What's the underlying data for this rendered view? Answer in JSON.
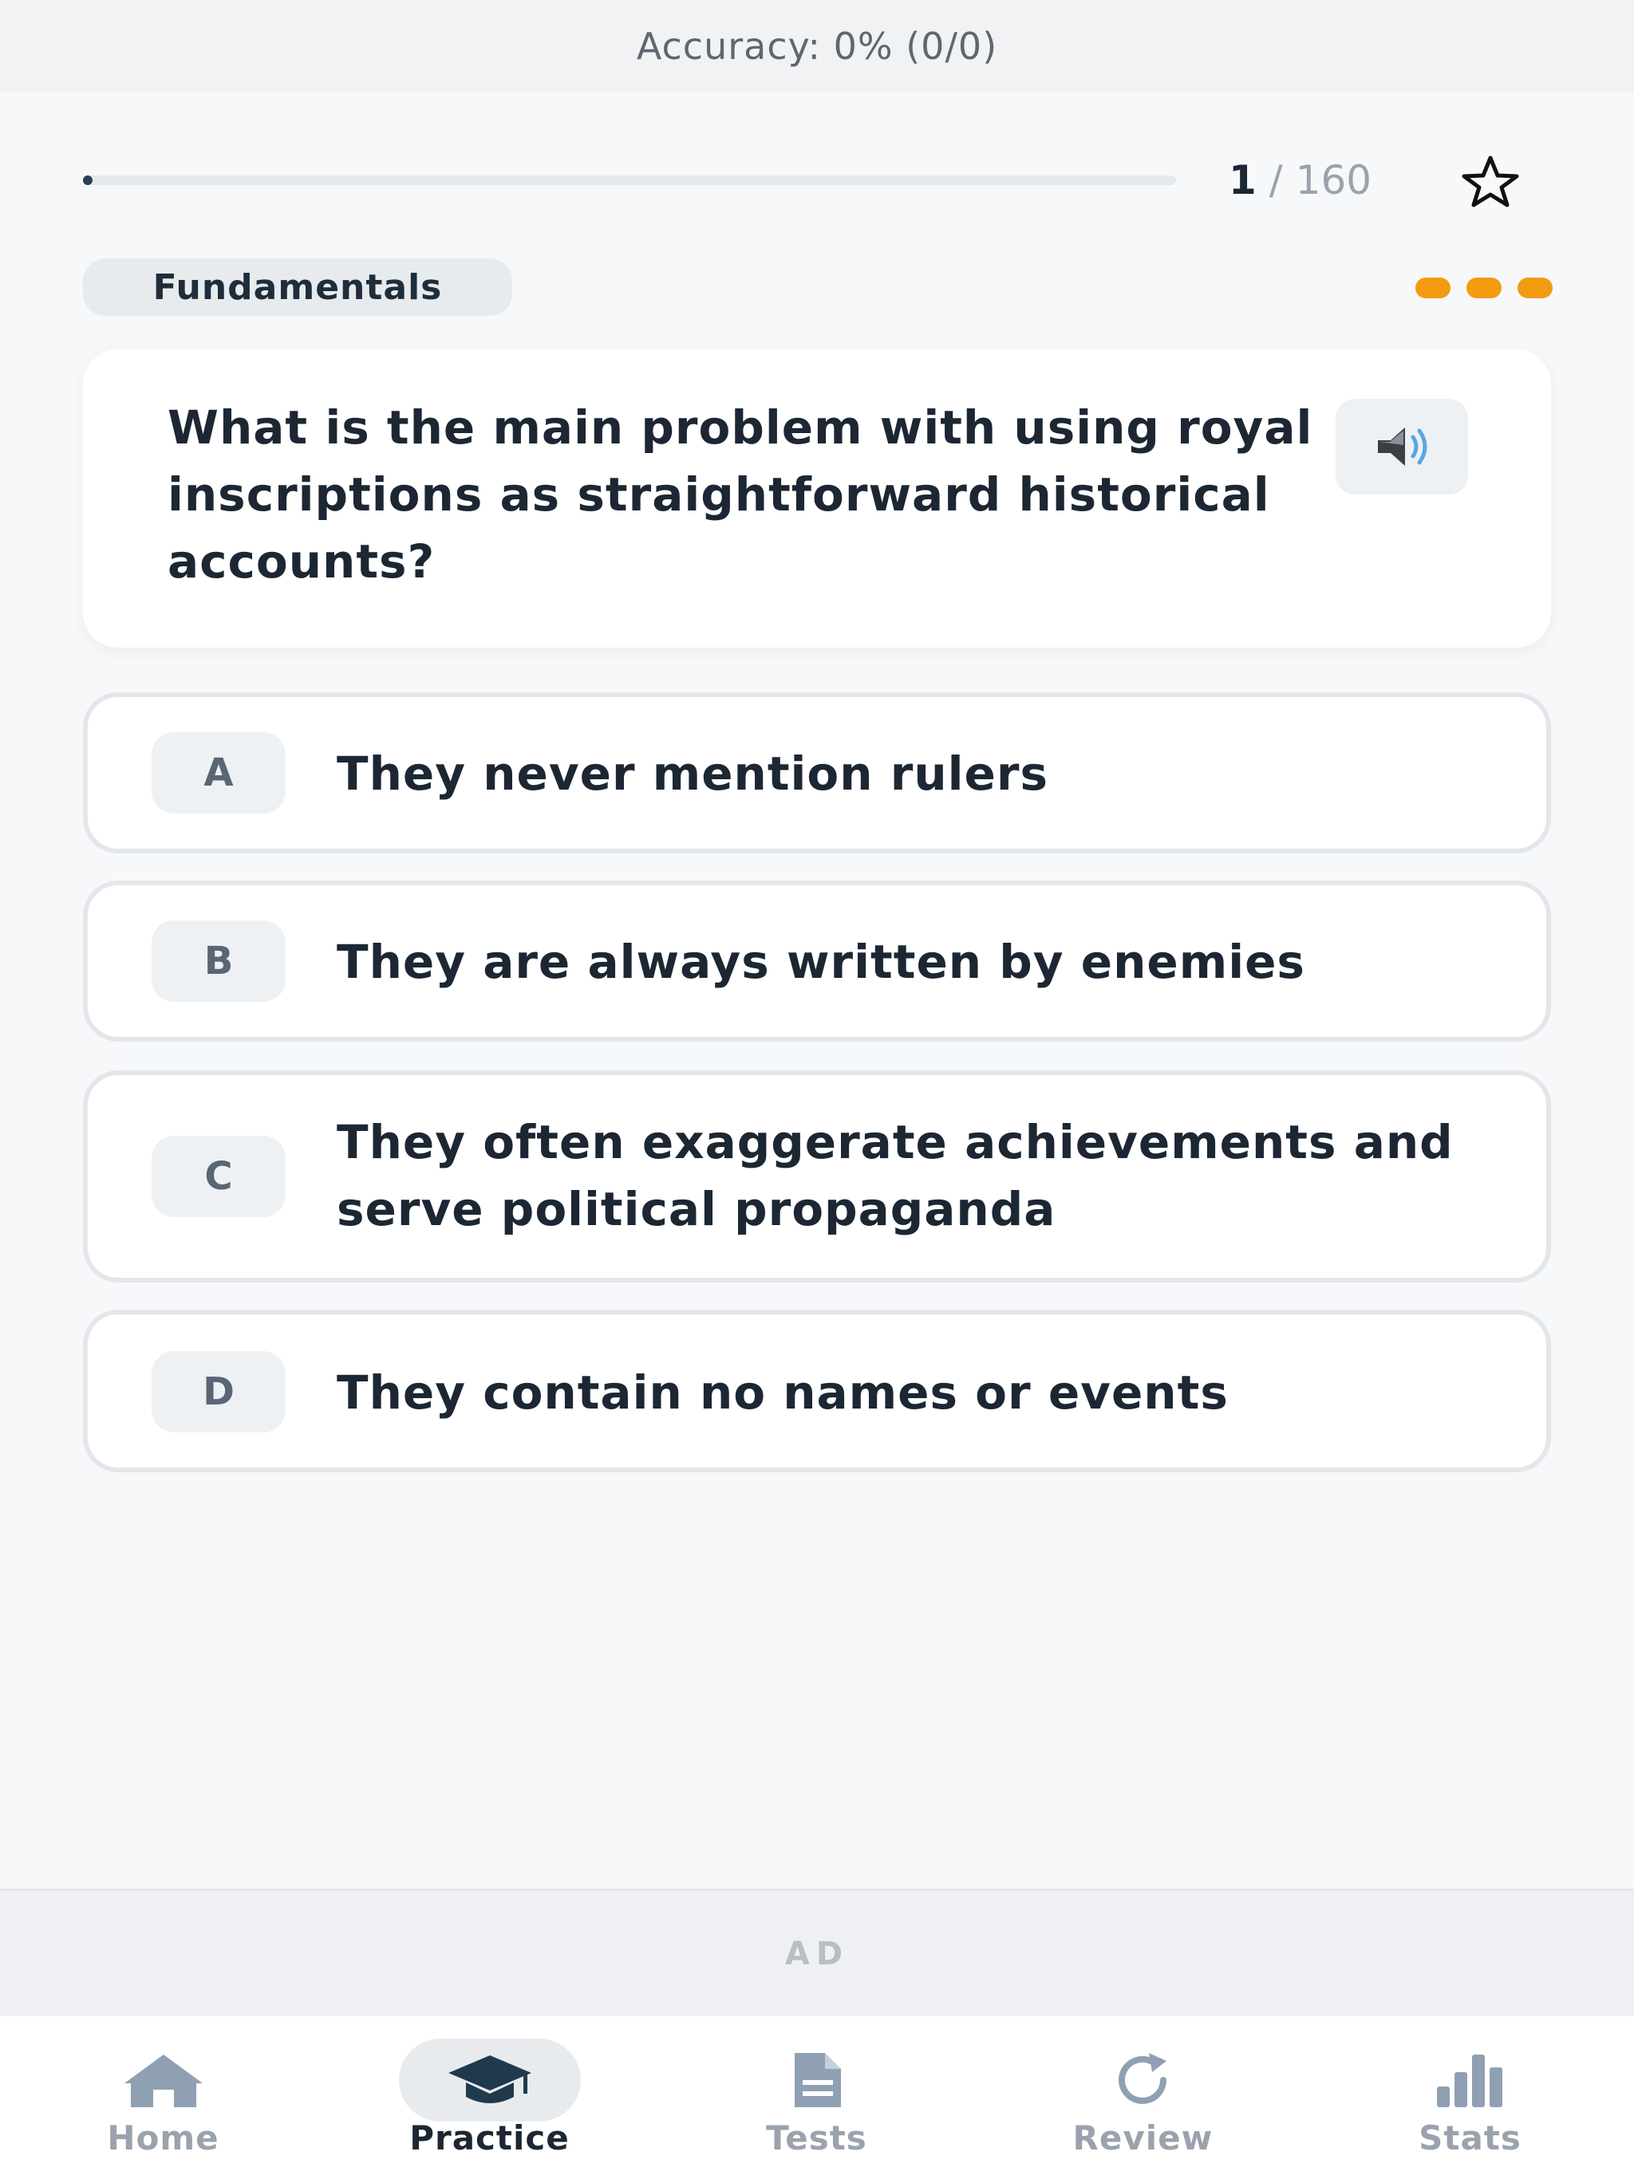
{
  "header": {
    "accuracy_text": "Accuracy: 0% (0/0)"
  },
  "progress": {
    "current": "1",
    "separator": "/",
    "total": "160",
    "fraction": 0.00625
  },
  "category": {
    "label": "Fundamentals"
  },
  "question": {
    "text": "What is the main problem with using royal inscriptions as straightforward historical accounts?"
  },
  "options": [
    {
      "letter": "A",
      "text": "They never mention rulers"
    },
    {
      "letter": "B",
      "text": "They are always written by enemies"
    },
    {
      "letter": "C",
      "text": "They often exaggerate achievements and serve political propaganda"
    },
    {
      "letter": "D",
      "text": "They contain no names or events"
    }
  ],
  "ad": {
    "label": "AD"
  },
  "tabs": [
    {
      "label": "Home",
      "icon": "home-icon",
      "active": false
    },
    {
      "label": "Practice",
      "icon": "graduation-cap-icon",
      "active": true
    },
    {
      "label": "Tests",
      "icon": "document-icon",
      "active": false
    },
    {
      "label": "Review",
      "icon": "refresh-icon",
      "active": false
    },
    {
      "label": "Stats",
      "icon": "bar-chart-icon",
      "active": false
    }
  ],
  "colors": {
    "accent": "#f39c12",
    "primary": "#2c3e50",
    "muted": "#9aa3ad"
  }
}
